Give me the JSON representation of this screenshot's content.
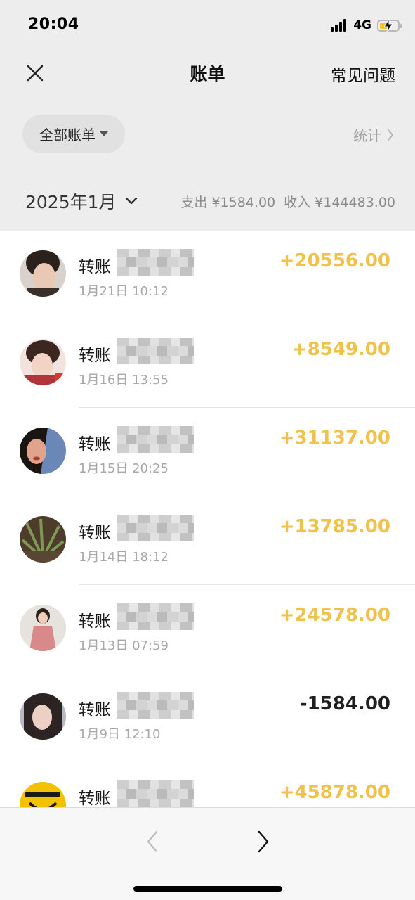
{
  "status_bar": {
    "time": "20:04",
    "network": "4G",
    "battery_level": 0.55,
    "battery_charging": true
  },
  "nav": {
    "title": "账单",
    "faq_label": "常见问题",
    "close_icon": "close-icon"
  },
  "filter": {
    "label": "全部账单",
    "stats_label": "统计"
  },
  "month": {
    "label": "2025年1月",
    "expense": "支出 ¥1584.00",
    "income": "收入 ¥144483.00"
  },
  "colors": {
    "income": "#f0c14b",
    "expense": "#1f1f1f",
    "header_bg": "#ededed"
  },
  "transactions": [
    {
      "title": "转账",
      "time": "1月21日 10:12",
      "amount": "+20556.00",
      "direction": "in"
    },
    {
      "title": "转账",
      "time": "1月16日 13:55",
      "amount": "+8549.00",
      "direction": "in"
    },
    {
      "title": "转账",
      "time": "1月15日 20:25",
      "amount": "+31137.00",
      "direction": "in"
    },
    {
      "title": "转账",
      "time": "1月14日 18:12",
      "amount": "+13785.00",
      "direction": "in"
    },
    {
      "title": "转账",
      "time": "1月13日 07:59",
      "amount": "+24578.00",
      "direction": "in"
    },
    {
      "title": "转账",
      "time": "1月9日 12:10",
      "amount": "-1584.00",
      "direction": "out"
    },
    {
      "title": "转账",
      "time": "",
      "amount": "+45878.00",
      "direction": "in"
    }
  ],
  "bottom_bar": {
    "back_icon": "chevron-left-icon",
    "forward_icon": "chevron-right-icon"
  }
}
